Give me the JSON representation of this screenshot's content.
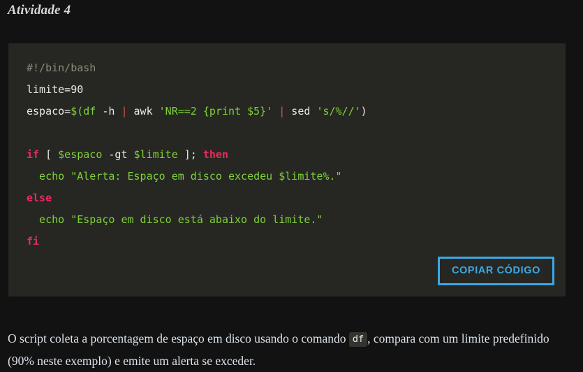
{
  "page": {
    "background_color": "#121212",
    "title": "Atividade 4"
  },
  "code_block": {
    "background_color": "#262722",
    "language": "bash",
    "plain_text": "#!/bin/bash\nlimite=90\nespaco=$(df -h | awk 'NR==2 {print $5}' | sed 's/%//')\n\nif [ $espaco -gt $limite ]; then\n  echo \"Alerta: Espaço em disco excedeu $limite%.\"\nelse\n  echo \"Espaço em disco está abaixo do limite.\"\nfi",
    "lines": [
      {
        "id": "line-1",
        "tokens": [
          {
            "t": "#!/bin/bash",
            "c": "comment"
          }
        ]
      },
      {
        "id": "line-2",
        "tokens": [
          {
            "t": "limite=90",
            "c": "plain"
          }
        ]
      },
      {
        "id": "line-3",
        "tokens": [
          {
            "t": "espaco=",
            "c": "plain"
          },
          {
            "t": "$(",
            "c": "green"
          },
          {
            "t": "df",
            "c": "green"
          },
          {
            "t": " -h ",
            "c": "plain"
          },
          {
            "t": "|",
            "c": "pipe"
          },
          {
            "t": " awk ",
            "c": "plain"
          },
          {
            "t": "'NR==2 {print $5}'",
            "c": "green"
          },
          {
            "t": " ",
            "c": "plain"
          },
          {
            "t": "|",
            "c": "pipe"
          },
          {
            "t": " sed ",
            "c": "plain"
          },
          {
            "t": "'s/%//'",
            "c": "green"
          },
          {
            "t": ")",
            "c": "plain"
          }
        ]
      },
      {
        "id": "line-4",
        "tokens": [
          {
            "t": " ",
            "c": "plain"
          }
        ]
      },
      {
        "id": "line-5",
        "tokens": [
          {
            "t": "if",
            "c": "key"
          },
          {
            "t": " [ ",
            "c": "plain"
          },
          {
            "t": "$espaco",
            "c": "green"
          },
          {
            "t": " -gt ",
            "c": "plain"
          },
          {
            "t": "$limite",
            "c": "green"
          },
          {
            "t": " ]; ",
            "c": "plain"
          },
          {
            "t": "then",
            "c": "key"
          }
        ]
      },
      {
        "id": "line-6",
        "tokens": [
          {
            "t": "  echo ",
            "c": "green"
          },
          {
            "t": "\"Alerta: Espaço em disco excedeu $limite%.\"",
            "c": "green"
          }
        ]
      },
      {
        "id": "line-7",
        "tokens": [
          {
            "t": "else",
            "c": "key"
          }
        ]
      },
      {
        "id": "line-8",
        "tokens": [
          {
            "t": "  echo ",
            "c": "green"
          },
          {
            "t": "\"Espaço em disco está abaixo do limite.\"",
            "c": "green"
          }
        ]
      },
      {
        "id": "line-9",
        "tokens": [
          {
            "t": "fi",
            "c": "key"
          }
        ]
      }
    ],
    "copy_button": {
      "label": "COPIAR CÓDIGO",
      "border_color": "#3aa8e8",
      "text_color": "#3aa8e8"
    }
  },
  "description": {
    "part1": "O script coleta a porcentagem de espaço em disco usando o comando ",
    "inline_code": "df",
    "part2": ", compara com um limite predefinido (90% neste exemplo) e emite um alerta se exceder."
  },
  "syntax_colors": {
    "comment": "#8c8c7c",
    "plain": "#e8e8e8",
    "green": "#7fd13b",
    "keyword": "#e82a5e",
    "pipe": "#d4544f"
  }
}
